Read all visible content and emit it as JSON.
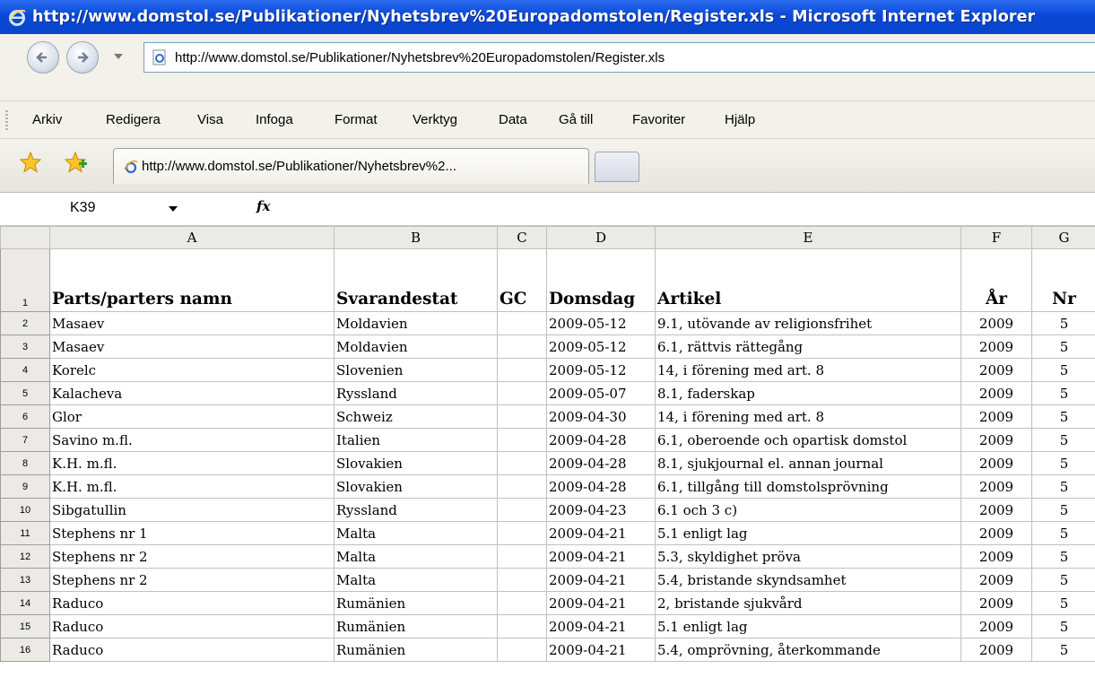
{
  "window": {
    "title": "http://www.domstol.se/Publikationer/Nyhetsbrev%20Europadomstolen/Register.xls - Microsoft Internet Explorer"
  },
  "address": {
    "url": "http://www.domstol.se/Publikationer/Nyhetsbrev%20Europadomstolen/Register.xls"
  },
  "menu": {
    "items": [
      "Arkiv",
      "Redigera",
      "Visa",
      "Infoga",
      "Format",
      "Verktyg",
      "Data",
      "Gå till",
      "Favoriter",
      "Hjälp"
    ]
  },
  "tab": {
    "title": "http://www.domstol.se/Publikationer/Nyhetsbrev%2..."
  },
  "formula_bar": {
    "cell_ref": "K39",
    "fx_label": "fx"
  },
  "sheet": {
    "columns": [
      "A",
      "B",
      "C",
      "D",
      "E",
      "F",
      "G"
    ],
    "header": [
      "Parts/parters namn",
      "Svarandestat",
      "GC",
      "Domsdag",
      "Artikel",
      "År",
      "Nr"
    ],
    "rows": [
      {
        "n": "2",
        "cells": [
          "Masaev",
          "Moldavien",
          "",
          "2009-05-12",
          "9.1, utövande av religionsfrihet",
          "2009",
          "5"
        ]
      },
      {
        "n": "3",
        "cells": [
          "Masaev",
          "Moldavien",
          "",
          "2009-05-12",
          "6.1, rättvis rättegång",
          "2009",
          "5"
        ]
      },
      {
        "n": "4",
        "cells": [
          "Korelc",
          "Slovenien",
          "",
          "2009-05-12",
          "14, i förening med art. 8",
          "2009",
          "5"
        ]
      },
      {
        "n": "5",
        "cells": [
          "Kalacheva",
          "Ryssland",
          "",
          "2009-05-07",
          "8.1, faderskap",
          "2009",
          "5"
        ]
      },
      {
        "n": "6",
        "cells": [
          "Glor",
          "Schweiz",
          "",
          "2009-04-30",
          "14, i förening med art. 8",
          "2009",
          "5"
        ]
      },
      {
        "n": "7",
        "cells": [
          "Savino m.fl.",
          "Italien",
          "",
          "2009-04-28",
          "6.1, oberoende och opartisk domstol",
          "2009",
          "5"
        ]
      },
      {
        "n": "8",
        "cells": [
          "K.H. m.fl.",
          "Slovakien",
          "",
          "2009-04-28",
          "8.1, sjukjournal el. annan journal",
          "2009",
          "5"
        ]
      },
      {
        "n": "9",
        "cells": [
          "K.H. m.fl.",
          "Slovakien",
          "",
          "2009-04-28",
          "6.1, tillgång till domstolsprövning",
          "2009",
          "5"
        ]
      },
      {
        "n": "10",
        "cells": [
          "Sibgatullin",
          "Ryssland",
          "",
          "2009-04-23",
          "6.1 och 3 c)",
          "2009",
          "5"
        ]
      },
      {
        "n": "11",
        "cells": [
          "Stephens nr 1",
          "Malta",
          "",
          "2009-04-21",
          "5.1 enligt lag",
          "2009",
          "5"
        ]
      },
      {
        "n": "12",
        "cells": [
          "Stephens nr 2",
          "Malta",
          "",
          "2009-04-21",
          "5.3, skyldighet pröva",
          "2009",
          "5"
        ]
      },
      {
        "n": "13",
        "cells": [
          "Stephens nr 2",
          "Malta",
          "",
          "2009-04-21",
          "5.4, bristande skyndsamhet",
          "2009",
          "5"
        ]
      },
      {
        "n": "14",
        "cells": [
          "Raduco",
          "Rumänien",
          "",
          "2009-04-21",
          "2, bristande sjukvård",
          "2009",
          "5"
        ]
      },
      {
        "n": "15",
        "cells": [
          "Raduco",
          "Rumänien",
          "",
          "2009-04-21",
          "5.1 enligt lag",
          "2009",
          "5"
        ]
      },
      {
        "n": "16",
        "cells": [
          "Raduco",
          "Rumänien",
          "",
          "2009-04-21",
          "5.4, omprövning, återkommande",
          "2009",
          "5"
        ]
      }
    ]
  }
}
